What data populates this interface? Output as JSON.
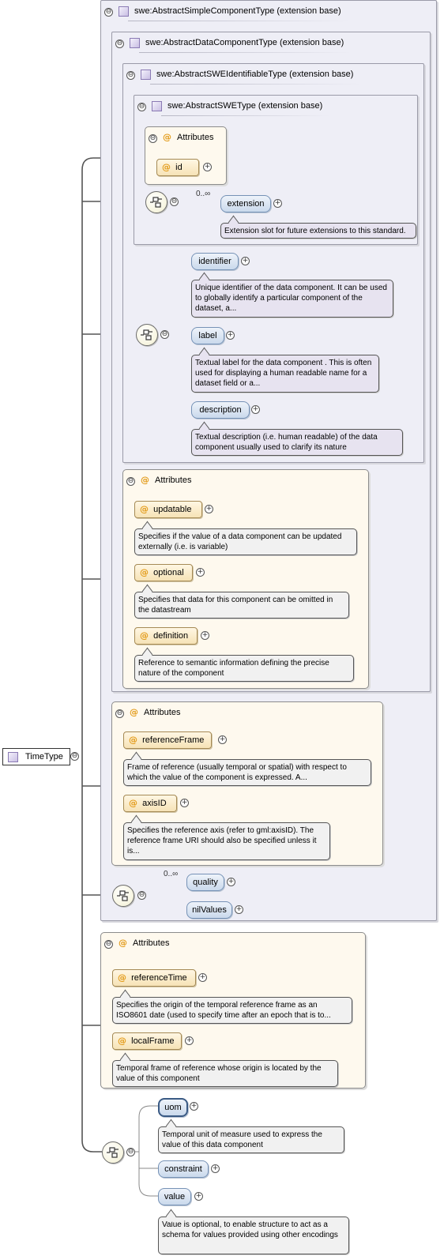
{
  "root": {
    "label": "TimeType"
  },
  "ext_boxes": {
    "simple": "swe:AbstractSimpleComponentType (extension base)",
    "data": "swe:AbstractDataComponentType (extension base)",
    "identifiable": "swe:AbstractSWEIdentifiableType (extension base)",
    "swe": "swe:AbstractSWEType (extension base)"
  },
  "attributes_heading": "Attributes",
  "at_symbol": "@",
  "minus_glyph": "⊖",
  "plus_glyph": "+",
  "cardinality": "0..∞",
  "swe_type": {
    "attr_id": "id",
    "extension": {
      "label": "extension",
      "doc": "Extension slot for future extensions to this standard."
    }
  },
  "identifiable": {
    "identifier": {
      "label": "identifier",
      "doc": "Unique identifier of the data component. It can be used to globally identify a particular component of the dataset, a..."
    },
    "label": {
      "label": "label",
      "doc": "Textual label for the data component . This is often used for displaying a human readable name for a dataset field or a..."
    },
    "description": {
      "label": "description",
      "doc": "Textual description (i.e. human readable) of the data component usually used to clarify its nature"
    }
  },
  "data_attrs": {
    "updatable": {
      "label": "updatable",
      "doc": "Specifies if the value of a data component can be updated externally (i.e. is variable)"
    },
    "optional": {
      "label": "optional",
      "doc": "Specifies that data for this component can be omitted in the datastream"
    },
    "definition": {
      "label": "definition",
      "doc": "Reference to semantic information defining the precise nature of the component"
    }
  },
  "simple_attrs": {
    "referenceFrame": {
      "label": "referenceFrame",
      "doc": "Frame of reference (usually temporal or spatial) with respect to which the value of the component is expressed. A..."
    },
    "axisID": {
      "label": "axisID",
      "doc": "Specifies the reference axis (refer to gml:axisID). The reference frame URI should also be specified unless it is..."
    }
  },
  "simple_seq": {
    "quality": "quality",
    "nilValues": "nilValues"
  },
  "time_attrs": {
    "referenceTime": {
      "label": "referenceTime",
      "doc": "Specifies the origin of the temporal reference frame as an ISO8601 date (used to specify time after an epoch that is to..."
    },
    "localFrame": {
      "label": "localFrame",
      "doc": "Temporal frame of reference whose origin is located by the value of this component"
    }
  },
  "time_seq": {
    "uom": {
      "label": "uom",
      "doc": "Temporal unit of measure used to express the value of this data component"
    },
    "constraint": {
      "label": "constraint"
    },
    "value": {
      "label": "value",
      "doc": "Value is optional, to enable structure to act as a schema for values provided using other encodings"
    }
  }
}
